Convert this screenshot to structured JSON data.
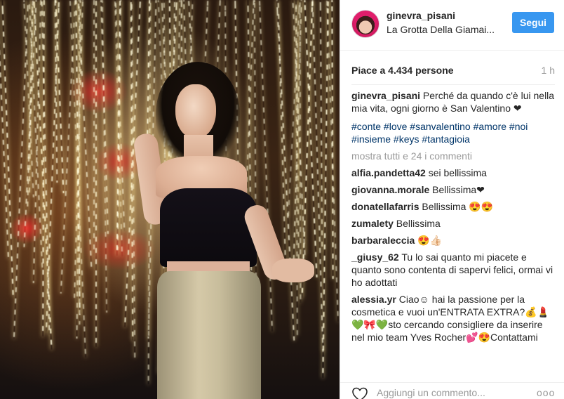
{
  "post": {
    "username": "ginevra_pisani",
    "location": "La Grotta Della Giamai...",
    "follow_label": "Segui",
    "likes": "Piace a 4.434 persone",
    "time": "1 h",
    "caption_user": "ginevra_pisani",
    "caption_text": " Perché da quando c'è lui nella mia vita, ogni giorno è San Valentino ❤",
    "hashtags": "#conte #love #sanvalentino #amore #noi #insieme #keys #tantagioia",
    "view_all": "mostra tutti e 24 i commenti",
    "add_comment_placeholder": "Aggiungi un commento...",
    "more": "ooo"
  },
  "comments": [
    {
      "user": "alfia.pandetta42",
      "text": " sei bellissima"
    },
    {
      "user": "giovanna.morale",
      "text": " Bellissima❤"
    },
    {
      "user": "donatellafarris",
      "text": " Bellissima 😍😍"
    },
    {
      "user": "zumalety",
      "text": " Bellissima"
    },
    {
      "user": "barbaraleccia",
      "text": " 😍👍🏻"
    },
    {
      "user": "_giusy_62",
      "text": " Tu lo sai quanto mi piacete e quanto sono contenta di sapervi felici, ormai vi ho adottati"
    },
    {
      "user": "alessia.yr",
      "text": " Ciao☺ hai la passione per la cosmetica e vuoi un'ENTRATA EXTRA?💰💄 💚🎀💚sto cercando consigliere da inserire nel mio team Yves Rocher💕😍Contattami"
    }
  ],
  "icons": {
    "heart": "heart-icon",
    "more": "more-options-icon"
  },
  "colors": {
    "follow_button": "#3897f0",
    "hashtag": "#003569",
    "muted": "#999999"
  }
}
